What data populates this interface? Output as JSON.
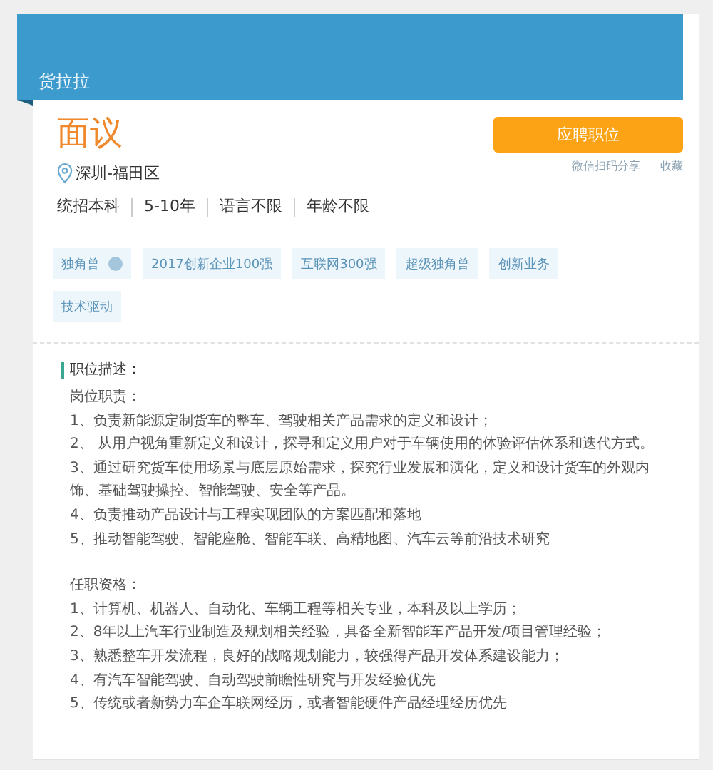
{
  "banner": {
    "company": "货拉拉"
  },
  "job": {
    "title": "面议",
    "apply_button": "应聘职位",
    "share_link": "微信扫码分享",
    "favorite_link": "收藏",
    "location": "深圳-福田区",
    "requirements": [
      "统招本科",
      "5-10年",
      "语言不限",
      "年龄不限"
    ]
  },
  "tags": [
    {
      "label": "独角兽",
      "info": true
    },
    {
      "label": "2017创新企业100强",
      "info": false
    },
    {
      "label": "互联网300强",
      "info": false
    },
    {
      "label": "超级独角兽",
      "info": false
    },
    {
      "label": "创新业务",
      "info": false
    },
    {
      "label": "技术驱动",
      "info": false
    }
  ],
  "description": {
    "heading": "职位描述：",
    "sections": [
      {
        "title": "岗位职责：",
        "items": [
          "1、负责新能源定制货车的整车、驾驶相关产品需求的定义和设计；",
          "2、 从用户视角重新定义和设计，探寻和定义用户对于车辆使用的体验评估体系和迭代方式。",
          "3、通过研究货车使用场景与底层原始需求，探究行业发展和演化，定义和设计货车的外观内饰、基础驾驶操控、智能驾驶、安全等产品。",
          "4、负责推动产品设计与工程实现团队的方案匹配和落地",
          "5、推动智能驾驶、智能座舱、智能车联、高精地图、汽车云等前沿技术研究"
        ]
      },
      {
        "title": "任职资格：",
        "items": [
          "1、计算机、机器人、自动化、车辆工程等相关专业，本科及以上学历；",
          "2、8年以上汽车行业制造及规划相关经验，具备全新智能车产品开发/项目管理经验；",
          "3、熟悉整车开发流程，良好的战略规划能力，较强得产品开发体系建设能力；",
          "4、有汽车智能驾驶、自动驾驶前瞻性研究与开发经验优先",
          "5、传统或者新势力车企车联网经历，或者智能硬件产品经理经历优先"
        ]
      }
    ]
  }
}
